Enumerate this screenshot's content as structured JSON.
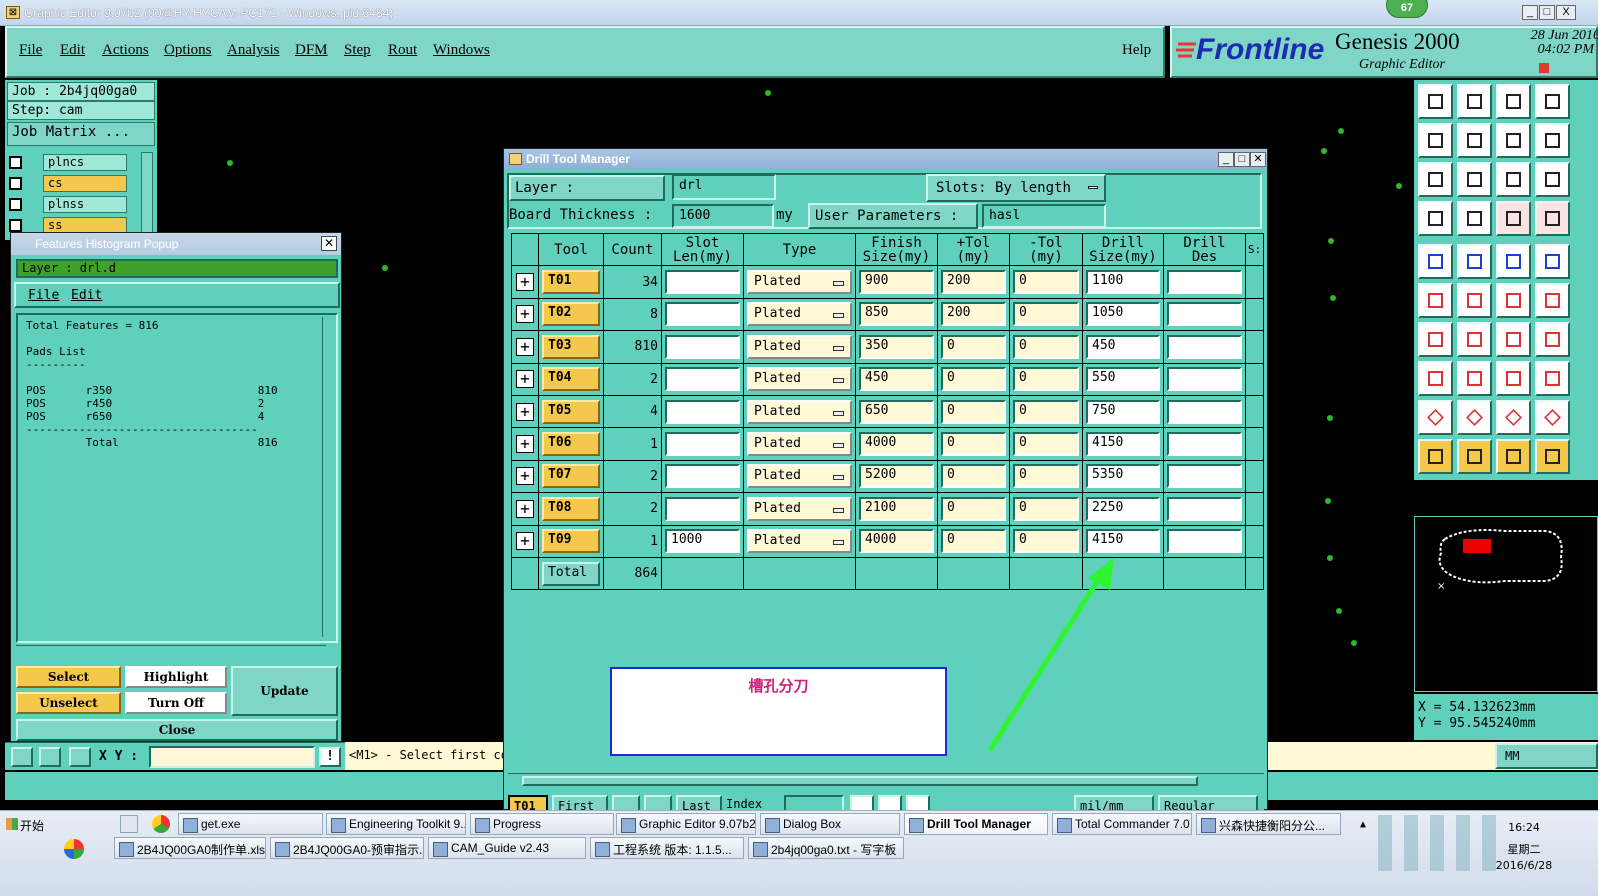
{
  "window": {
    "title": "Graphic Editor 9.07b2 (00@HY-HYCAM-PC171 - Windows, pid:6484)",
    "badge": "67",
    "btn_min": "_",
    "btn_max": "□",
    "btn_close": "X"
  },
  "menu": [
    "File",
    "Edit",
    "Actions",
    "Options",
    "Analysis",
    "DFM",
    "Step",
    "Rout",
    "Windows"
  ],
  "help": "Help",
  "brand": {
    "logo": "Frontline",
    "product": "Genesis 2000",
    "sub": "Graphic Editor",
    "date": "28 Jun 2016",
    "time": "04:02 PM"
  },
  "job": {
    "job_line": "Job : 2b4jq00ga0",
    "step_line": "Step: cam",
    "matrix_btn": "Job Matrix ..."
  },
  "layers": [
    {
      "name": "plncs",
      "color": "#9fe8d8"
    },
    {
      "name": "cs",
      "color": "#f4c84d"
    },
    {
      "name": "plnss",
      "color": "#9fe8d8"
    },
    {
      "name": "ss",
      "color": "#f4c84d"
    }
  ],
  "histogram": {
    "title": "Features Histogram Popup",
    "layer_line": "Layer :  drl.d",
    "menu_file": "File",
    "menu_edit": "Edit",
    "text": "Total Features = 816\n\nPads List\n---------\n\nPOS      r350                      810\nPOS      r450                      2\nPOS      r650                      4\n-----------------------------------\n         Total                     816",
    "buttons": {
      "select": "Select",
      "highlight": "Highlight",
      "update": "Update",
      "unselect": "Unselect",
      "turn_off": "Turn Off",
      "close": "Close"
    }
  },
  "coord_bar": {
    "xy_label": "X Y :",
    "prompt": "<M1> - Select first co",
    "units": "MM"
  },
  "coords": {
    "x": "X  =  54.132623mm",
    "y": "Y  =  95.545240mm"
  },
  "dtm": {
    "title": "Drill Tool Manager",
    "layer_label": "Layer          :",
    "layer_value": "drl",
    "slots_label": "Slots:",
    "slots_value": "By length",
    "thick_label": "Board Thickness :",
    "thick_value": "1600",
    "thick_unit": "my",
    "user_label": "User Parameters :",
    "user_value": "hasl",
    "headers": [
      "Tool",
      "Count",
      "Slot\nLen(my)",
      "Type",
      "Finish\nSize(my)",
      "+Tol\n(my)",
      "-Tol\n(my)",
      "Drill\nSize(my)",
      "Drill\nDes",
      "S:"
    ],
    "rows": [
      {
        "tool": "T01",
        "count": "34",
        "slot": "",
        "type": "Plated",
        "finish": "900",
        "ptol": "200",
        "ntol": "0",
        "drill": "1100",
        "des": ""
      },
      {
        "tool": "T02",
        "count": "8",
        "slot": "",
        "type": "Plated",
        "finish": "850",
        "ptol": "200",
        "ntol": "0",
        "drill": "1050",
        "des": ""
      },
      {
        "tool": "T03",
        "count": "810",
        "slot": "",
        "type": "Plated",
        "finish": "350",
        "ptol": "0",
        "ntol": "0",
        "drill": "450",
        "des": ""
      },
      {
        "tool": "T04",
        "count": "2",
        "slot": "",
        "type": "Plated",
        "finish": "450",
        "ptol": "0",
        "ntol": "0",
        "drill": "550",
        "des": ""
      },
      {
        "tool": "T05",
        "count": "4",
        "slot": "",
        "type": "Plated",
        "finish": "650",
        "ptol": "0",
        "ntol": "0",
        "drill": "750",
        "des": ""
      },
      {
        "tool": "T06",
        "count": "1",
        "slot": "",
        "type": "Plated",
        "finish": "4000",
        "ptol": "0",
        "ntol": "0",
        "drill": "4150",
        "des": ""
      },
      {
        "tool": "T07",
        "count": "2",
        "slot": "",
        "type": "Plated",
        "finish": "5200",
        "ptol": "0",
        "ntol": "0",
        "drill": "5350",
        "des": ""
      },
      {
        "tool": "T08",
        "count": "2",
        "slot": "",
        "type": "Plated",
        "finish": "2100",
        "ptol": "0",
        "ntol": "0",
        "drill": "2250",
        "des": ""
      },
      {
        "tool": "T09",
        "count": "1",
        "slot": "1000",
        "type": "Plated",
        "finish": "4000",
        "ptol": "0",
        "ntol": "0",
        "drill": "4150",
        "des": ""
      }
    ],
    "total_label": "Total",
    "total_count": "864",
    "annotation": "槽孔分刀",
    "bottom": {
      "t01": "T01",
      "first": "First",
      "last": "Last",
      "index": "Index",
      "units": "mil/mm",
      "regular": "Regular"
    }
  },
  "taskbar": {
    "start": "开始",
    "row1": [
      "get.exe",
      "Engineering Toolkit 9....",
      "Progress",
      "Graphic Editor 9.07b2...",
      "Dialog Box",
      "Drill Tool Manager",
      "Total Commander 7.0 ...",
      "兴森快捷衡阳分公..."
    ],
    "row2": [
      "2B4JQ00GA0制作单.xls ...",
      "2B4JQ00GA0-预审指示....",
      "CAM_Guide v2.43",
      "工程系统  版本: 1.1.5...",
      "2b4jq00ga0.txt - 写字板"
    ],
    "clock": {
      "time": "16:24",
      "day": "星期二",
      "date": "2016/6/28"
    }
  }
}
